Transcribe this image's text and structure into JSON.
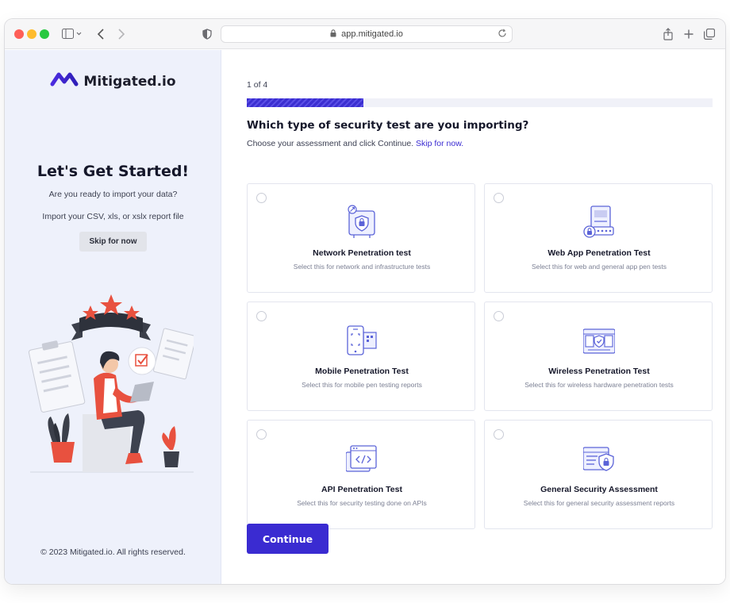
{
  "browser": {
    "url": "app.mitigated.io"
  },
  "sidebar": {
    "brand": "Mitigated.io",
    "title": "Let's Get Started!",
    "question": "Are you ready to import your data?",
    "formats": "Import your CSV, xls, or xslx report file",
    "skip_button": "Skip for now",
    "copyright": "© 2023 Mitigated.io. All rights reserved."
  },
  "main": {
    "step": "1 of 4",
    "progress": 0.25,
    "question": "Which type of security test are you importing?",
    "instruction": "Choose your assessment and click Continue.",
    "skip_link": "Skip for now.",
    "options": [
      {
        "title": "Network Penetration test",
        "desc": "Select this for network and infrastructure tests",
        "icon": "network-shield-icon",
        "selected": false
      },
      {
        "title": "Web App Penetration Test",
        "desc": "Select this for web and general app pen tests",
        "icon": "web-app-lock-icon",
        "selected": false
      },
      {
        "title": "Mobile Penetration Test",
        "desc": "Select this for mobile pen testing reports",
        "icon": "mobile-scan-icon",
        "selected": false
      },
      {
        "title": "Wireless Penetration Test",
        "desc": "Select this for wireless hardware penetration tests",
        "icon": "wireless-devices-icon",
        "selected": false
      },
      {
        "title": "API Penetration Test",
        "desc": "Select this for security testing done on APIs",
        "icon": "api-code-icon",
        "selected": false
      },
      {
        "title": "General Security Assessment",
        "desc": "Select this for general security assessment reports",
        "icon": "security-report-icon",
        "selected": false
      }
    ],
    "continue_button": "Continue"
  },
  "colors": {
    "accent": "#3a2bd1",
    "sidebar_bg": "#eef1fb",
    "icon_blue": "#5b63d8"
  }
}
